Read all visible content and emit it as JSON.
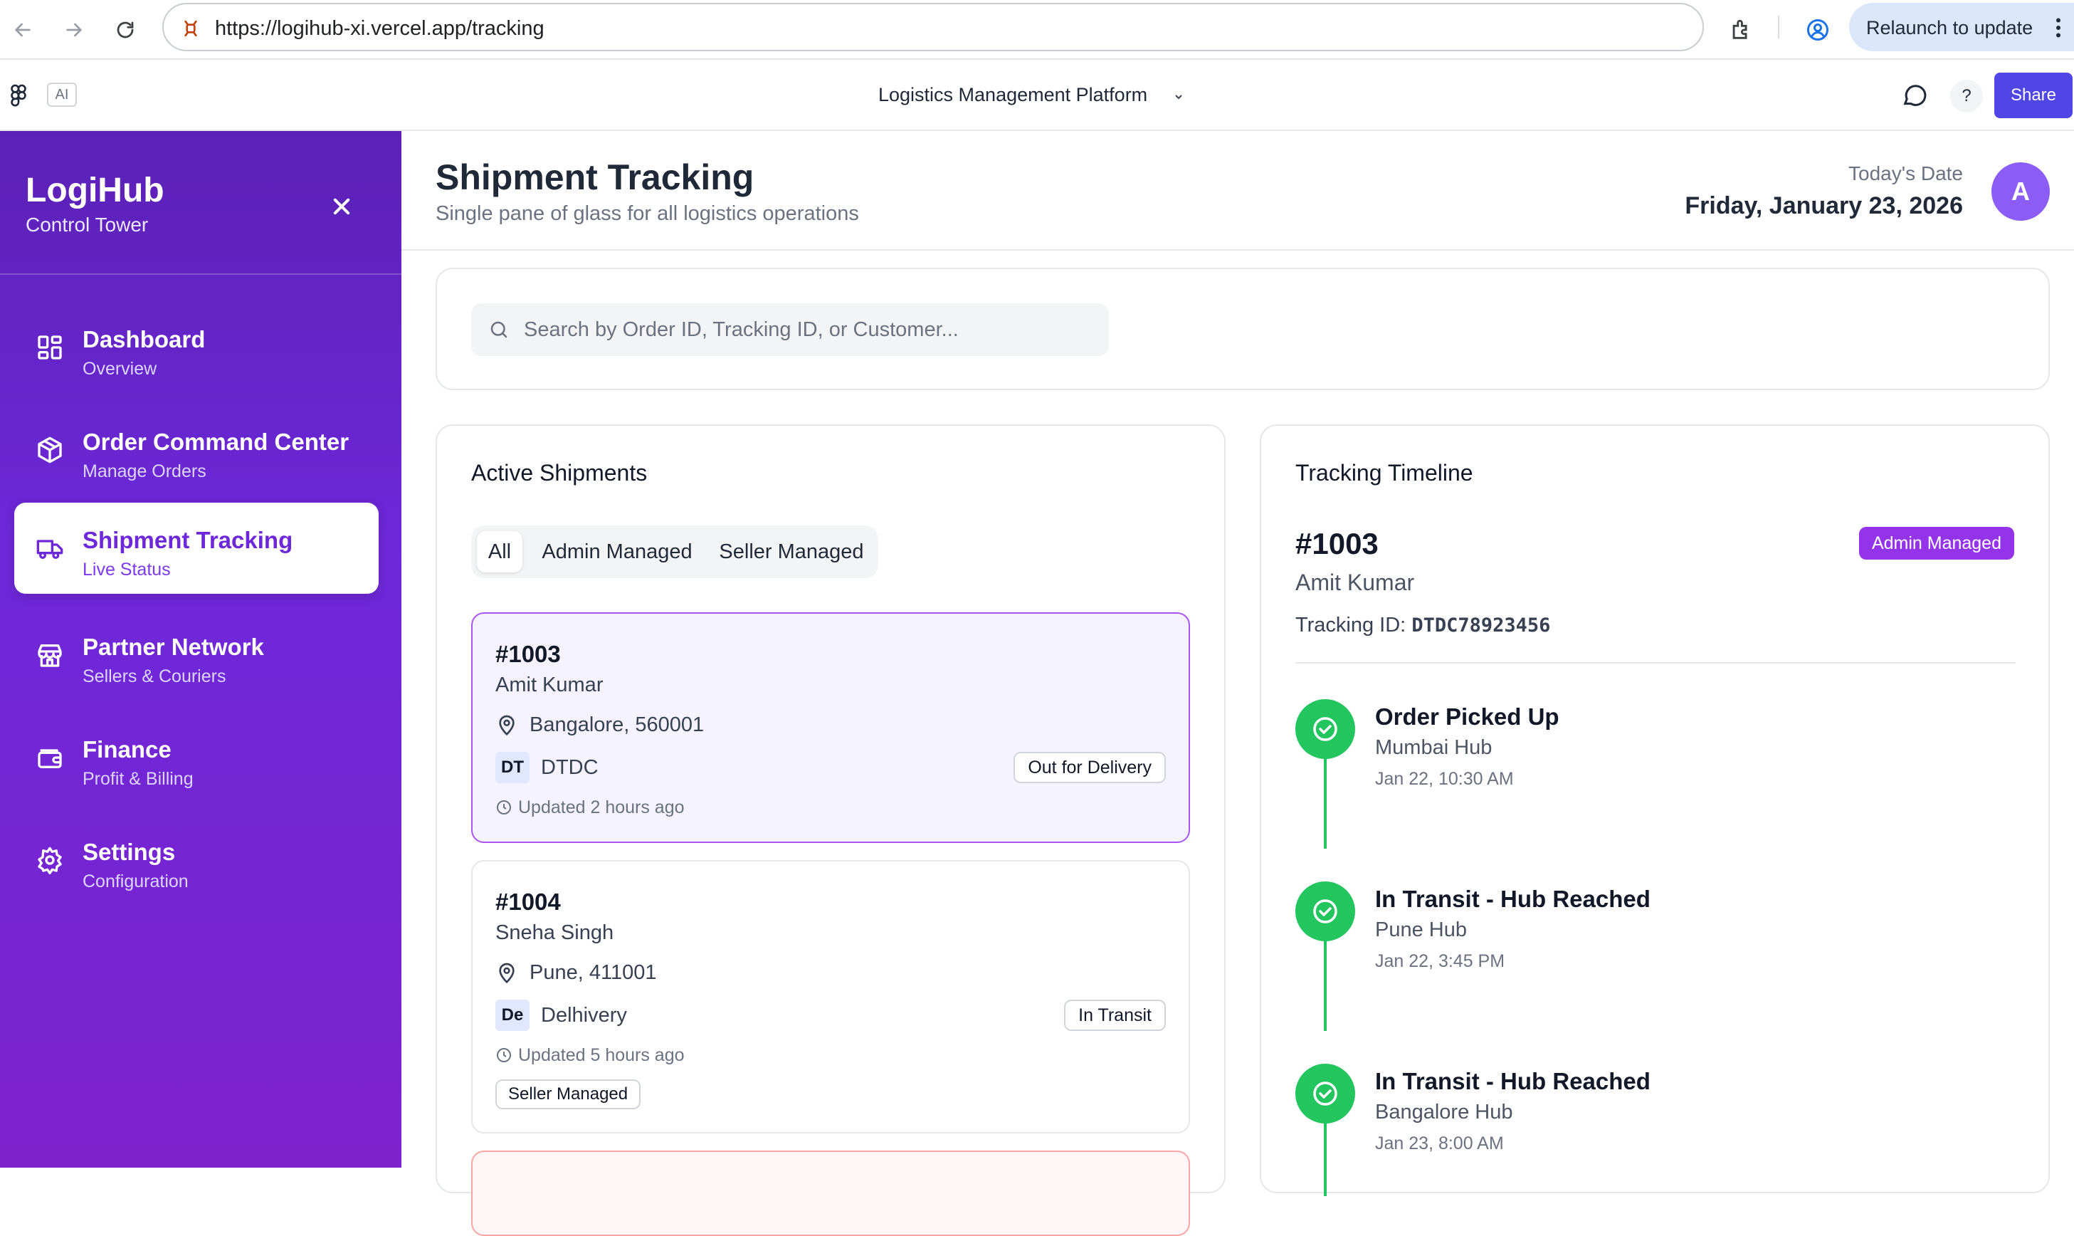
{
  "browser": {
    "url": "https://logihub-xi.vercel.app/tracking",
    "relaunch_label": "Relaunch to update"
  },
  "app_bar": {
    "ai_badge": "AI",
    "project_title": "Logistics Management Platform",
    "help_label": "?",
    "share_label": "Share"
  },
  "sidebar": {
    "brand_title": "LogiHub",
    "brand_subtitle": "Control Tower",
    "items": [
      {
        "label": "Dashboard",
        "sub": "Overview",
        "icon": "dashboard-icon"
      },
      {
        "label": "Order Command Center",
        "sub": "Manage Orders",
        "icon": "box-icon"
      },
      {
        "label": "Shipment Tracking",
        "sub": "Live Status",
        "icon": "truck-icon",
        "active": true
      },
      {
        "label": "Partner Network",
        "sub": "Sellers & Couriers",
        "icon": "store-icon"
      },
      {
        "label": "Finance",
        "sub": "Profit & Billing",
        "icon": "wallet-icon"
      },
      {
        "label": "Settings",
        "sub": "Configuration",
        "icon": "gear-icon"
      }
    ]
  },
  "header": {
    "title": "Shipment Tracking",
    "subtitle": "Single pane of glass for all logistics operations",
    "date_label": "Today's Date",
    "date_value": "Friday, January 23, 2026",
    "avatar_initial": "A"
  },
  "search": {
    "placeholder": "Search by Order ID, Tracking ID, or Customer...",
    "value": ""
  },
  "shipments": {
    "title": "Active Shipments",
    "filters": [
      "All",
      "Admin Managed",
      "Seller Managed"
    ],
    "active_filter": "All",
    "items": [
      {
        "id": "#1003",
        "customer": "Amit Kumar",
        "location": "Bangalore, 560001",
        "courier_code": "DT",
        "courier": "DTDC",
        "status": "Out for Delivery",
        "updated": "Updated 2 hours ago",
        "selected": true
      },
      {
        "id": "#1004",
        "customer": "Sneha Singh",
        "location": "Pune, 411001",
        "courier_code": "De",
        "courier": "Delhivery",
        "status": "In Transit",
        "updated": "Updated 5 hours ago",
        "management": "Seller Managed"
      }
    ]
  },
  "timeline": {
    "title": "Tracking Timeline",
    "order_id": "#1003",
    "customer": "Amit Kumar",
    "management": "Admin Managed",
    "tracking_label": "Tracking ID:",
    "tracking_id": "DTDC78923456",
    "events": [
      {
        "event": "Order Picked Up",
        "hub": "Mumbai Hub",
        "time": "Jan 22, 10:30 AM"
      },
      {
        "event": "In Transit - Hub Reached",
        "hub": "Pune Hub",
        "time": "Jan 22, 3:45 PM"
      },
      {
        "event": "In Transit - Hub Reached",
        "hub": "Bangalore Hub",
        "time": "Jan 23, 8:00 AM"
      }
    ]
  },
  "colors": {
    "brand_purple": "#6d28d9",
    "accent_indigo": "#4f46e5",
    "timeline_green": "#22c55e",
    "admin_badge": "#9333ea"
  }
}
